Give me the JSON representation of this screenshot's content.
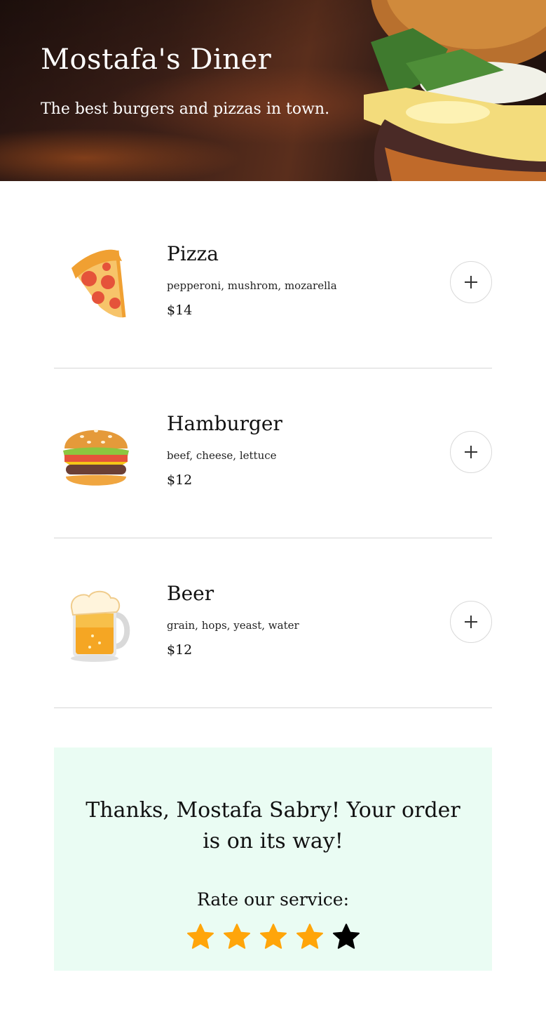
{
  "header": {
    "title": "Mostafa's Diner",
    "subtitle": "The best burgers and pizzas in town."
  },
  "menu": {
    "items": [
      {
        "name": "Pizza",
        "ingredients": "pepperoni, mushrom, mozarella",
        "price": "$14",
        "icon": "pizza-icon"
      },
      {
        "name": "Hamburger",
        "ingredients": "beef, cheese, lettuce",
        "price": "$12",
        "icon": "hamburger-icon"
      },
      {
        "name": "Beer",
        "ingredients": "grain, hops, yeast, water",
        "price": "$12",
        "icon": "beer-icon"
      }
    ],
    "add_icon": "plus-icon"
  },
  "order": {
    "message": "Thanks, Mostafa Sabry! Your order is on its way!",
    "rate_label": "Rate our service:",
    "rating": 4,
    "max_rating": 5
  },
  "colors": {
    "thanks_bg": "#eafcf3",
    "star_active": "#ffa50a",
    "star_inactive": "#000000",
    "divider": "#d6d6d6"
  }
}
